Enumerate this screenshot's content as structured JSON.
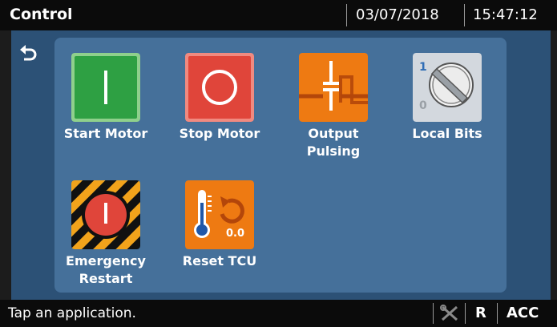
{
  "header": {
    "title": "Control",
    "date": "03/07/2018",
    "time": "15:47:12"
  },
  "apps": [
    {
      "label": "Start Motor",
      "icon": "start-motor-icon"
    },
    {
      "label": "Stop Motor",
      "icon": "stop-motor-icon"
    },
    {
      "label": "Output Pulsing",
      "icon": "output-pulsing-icon"
    },
    {
      "label": "Local Bits",
      "icon": "local-bits-icon"
    },
    {
      "label": "Emergency Restart",
      "icon": "emergency-restart-icon"
    },
    {
      "label": "Reset TCU",
      "icon": "reset-tcu-icon"
    }
  ],
  "local_bits_icon": {
    "on_label": "1",
    "off_label": "0"
  },
  "reset_tcu_icon": {
    "value": "0.0"
  },
  "footer": {
    "status": "Tap an application.",
    "indicator_r": "R",
    "indicator_acc": "ACC",
    "tools_icon": "tools-icon"
  },
  "colors": {
    "header_bg": "#0b0b0b",
    "main_bg": "#2c5176",
    "panel_bg": "#45709a",
    "start_green": "#2ea043",
    "stop_red": "#e0453a",
    "accent_orange": "#ee7a12"
  }
}
